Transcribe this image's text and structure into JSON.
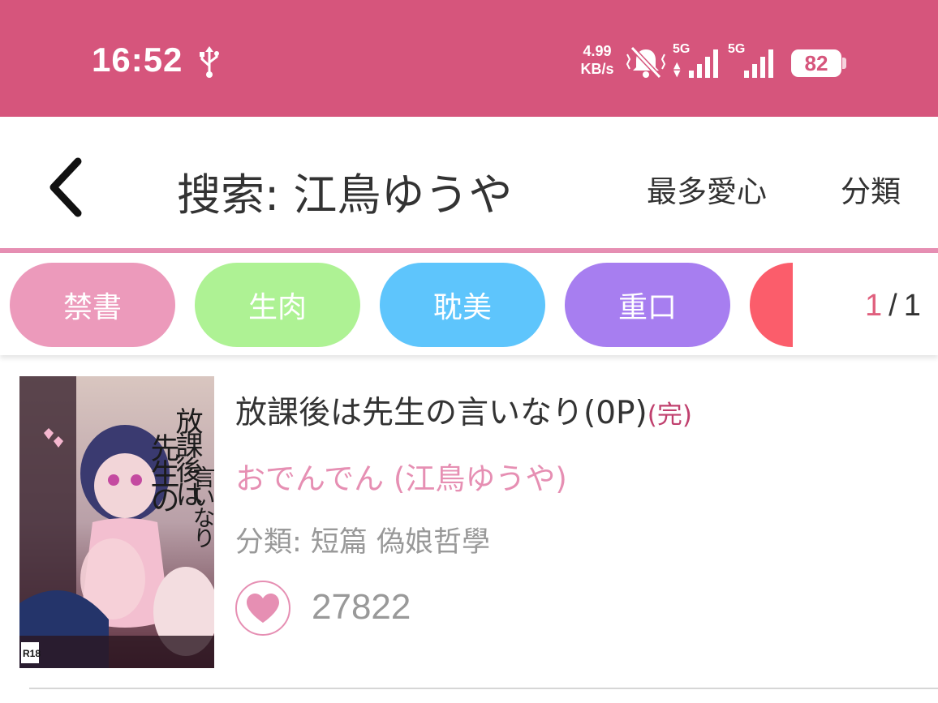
{
  "status_bar": {
    "time": "16:52",
    "net_speed_value": "4.99",
    "net_speed_unit": "KB/s",
    "signal1_label": "5G",
    "signal2_label": "5G",
    "battery": "82",
    "color": "#d6557c"
  },
  "header": {
    "title": "搜索:  江鳥ゆうや",
    "menu_most_liked": "最多愛心",
    "menu_category": "分類",
    "back_icon": "chevron-left-icon"
  },
  "tags": [
    {
      "label": "禁書",
      "color": "#ec9abb"
    },
    {
      "label": "生肉",
      "color": "#aef294"
    },
    {
      "label": "耽美",
      "color": "#5ec5fc"
    },
    {
      "label": "重口",
      "color": "#a77ef0"
    },
    {
      "label": "",
      "color": "#fb5d6b"
    }
  ],
  "pager": {
    "current": "1",
    "separator": "/",
    "total": "1"
  },
  "items": [
    {
      "title": "放課後は先生の言いなり(0P)",
      "status": "(完)",
      "author": "おでんでん (江鳥ゆうや)",
      "category": "分類:  短篇 偽娘哲學",
      "likes": "27822",
      "cover_title": "放課後は先生の言いなり",
      "cover_badge": "R18"
    }
  ]
}
